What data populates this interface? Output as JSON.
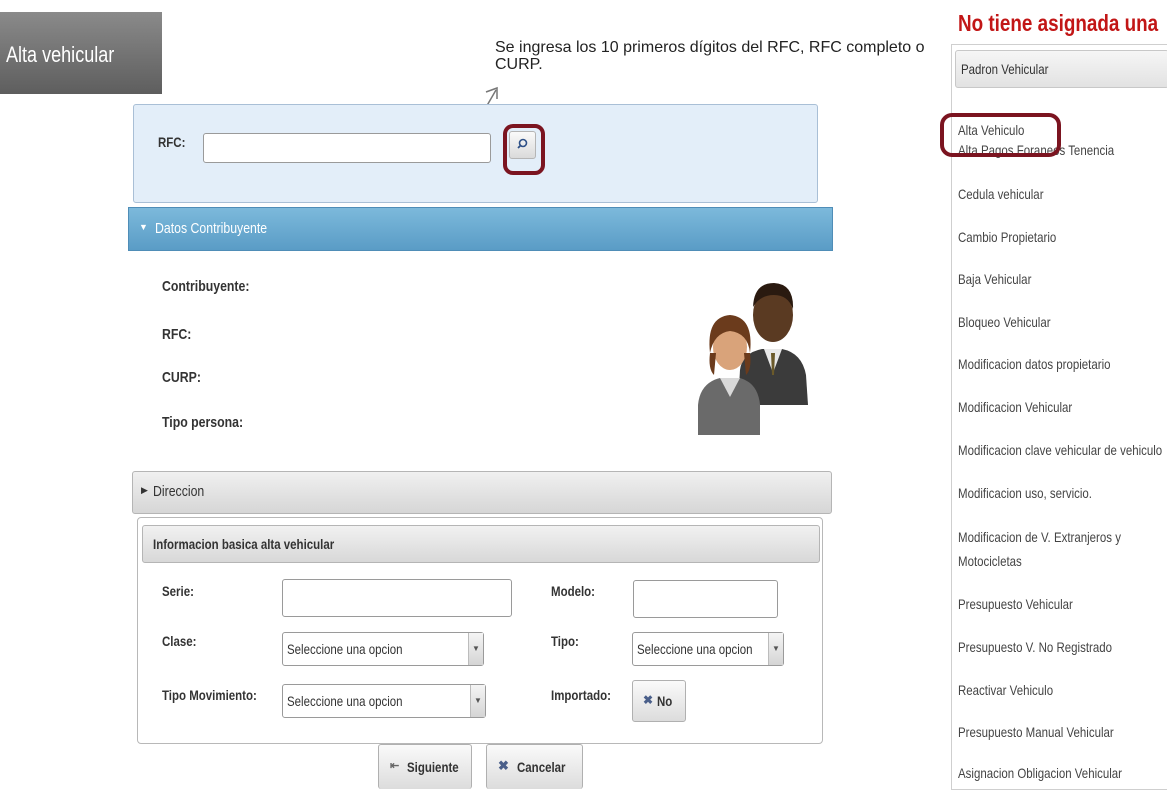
{
  "page_title": "Alta vehicular",
  "annotation": "Se ingresa los 10 primeros dígitos del RFC, RFC completo o CURP.",
  "rfc": {
    "label": "RFC:",
    "value": ""
  },
  "datos": {
    "header": "Datos Contribuyente",
    "contribuyente_label": "Contribuyente:",
    "rfc_label": "RFC:",
    "curp_label": "CURP:",
    "tipo_persona_label": "Tipo persona:"
  },
  "direccion": {
    "header": "Direccion"
  },
  "info": {
    "header": "Informacion basica alta vehicular",
    "serie_label": "Serie:",
    "modelo_label": "Modelo:",
    "clase_label": "Clase:",
    "clase_value": "Seleccione una opcion",
    "tipo_label": "Tipo:",
    "tipo_value": "Seleccione una opcion",
    "tipo_mov_label": "Tipo Movimiento:",
    "tipo_mov_value": "Seleccione una opcion",
    "importado_label": "Importado:",
    "importado_value": "No"
  },
  "buttons": {
    "siguiente": "Siguiente",
    "cancelar": "Cancelar"
  },
  "sidebar": {
    "title": "No tiene asignada una",
    "header": "Padron Vehicular",
    "items": [
      "Alta Vehiculo",
      "Alta Pagos Foraneos Tenencia",
      "Cedula vehicular",
      "Cambio Propietario",
      "Baja Vehicular",
      "Bloqueo Vehicular",
      "Modificacion datos propietario",
      "Modificacion Vehicular",
      "Modificacion clave vehicular de vehiculo",
      "Modificacion uso, servicio.",
      "Modificacion de V. Extranjeros y",
      "Motocicletas",
      "Presupuesto Vehicular",
      "Presupuesto V. No Registrado",
      "Reactivar Vehiculo",
      "Presupuesto Manual Vehicular",
      "Asignacion Obligacion Vehicular"
    ]
  },
  "colors": {
    "highlight": "#7b1420",
    "accent_blue": "#5a9cc6",
    "sidebar_title": "#c21616"
  },
  "icons": {
    "search": "search-icon",
    "users": "users-icon",
    "next": "next-icon",
    "cancel": "cancel-icon"
  }
}
